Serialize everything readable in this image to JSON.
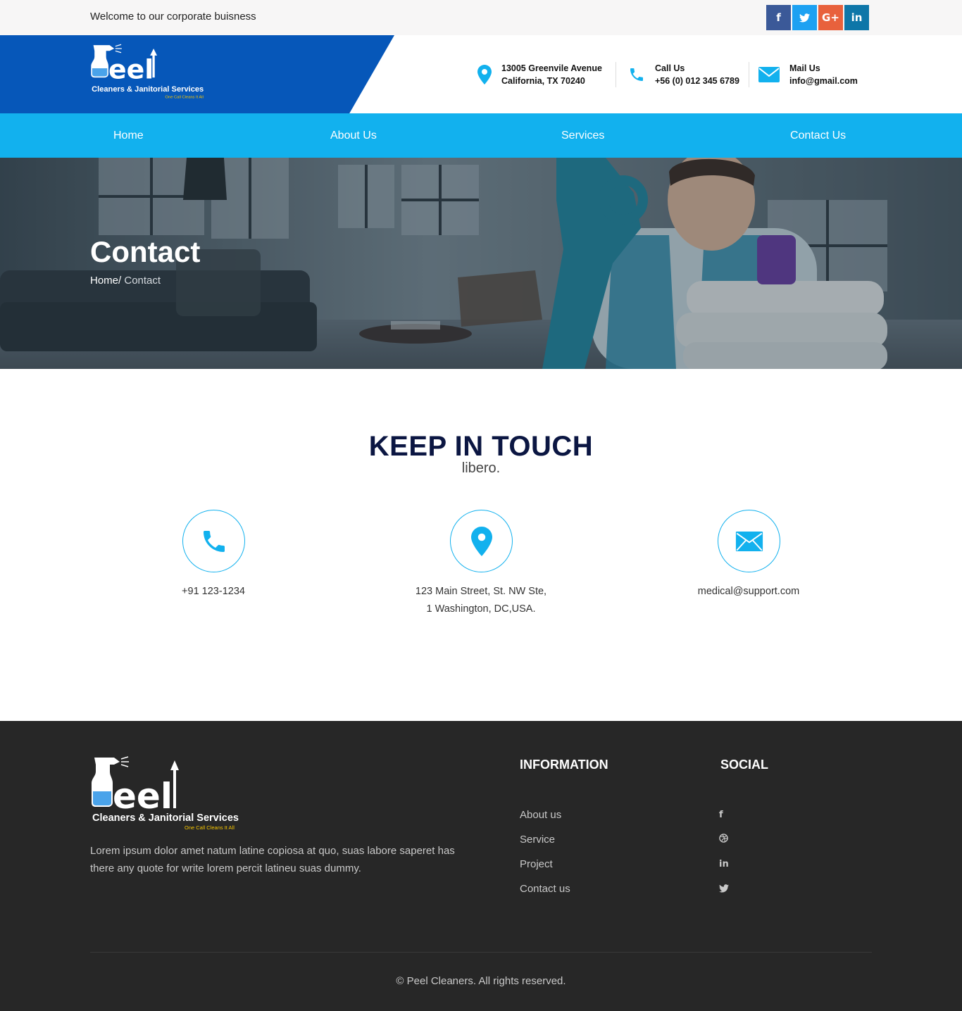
{
  "topbar": {
    "welcome": "Welcome to our corporate buisness",
    "social": [
      {
        "icon": "facebook-icon",
        "glyph": "f",
        "color": "#3b5998"
      },
      {
        "icon": "twitter-icon",
        "glyph": "t",
        "color": "#1da1f2"
      },
      {
        "icon": "google-plus-icon",
        "glyph": "G+",
        "color": "#dd4b39"
      },
      {
        "icon": "linkedin-icon",
        "glyph": "in",
        "color": "#0e76a8"
      }
    ]
  },
  "brand": {
    "name": "eel",
    "tagline": "Cleaners & Janitorial Services",
    "slogan": "One Call Cleans It All",
    "header_color": "#0657b9"
  },
  "header_contacts": {
    "address": {
      "line1": "13005 Greenvile Avenue",
      "line2": "California, TX 70240"
    },
    "phone": {
      "line1": "Call Us",
      "line2": "+56 (0) 012 345 6789"
    },
    "mail": {
      "line1": "Mail Us",
      "line2": "info@gmail.com"
    }
  },
  "nav": {
    "items": [
      "Home",
      "About Us",
      "Services",
      "Contact Us"
    ],
    "color": "#12b1ee"
  },
  "hero": {
    "title": "Contact",
    "breadcrumb_home": "Home/",
    "breadcrumb_current": " Contact"
  },
  "keep_in_touch": {
    "title": "KEEP IN TOUCH",
    "subtitle": "libero.",
    "phone": "+91 123-1234",
    "address_line1": "123 Main Street, St. NW Ste,",
    "address_line2": "1 Washington, DC,USA.",
    "email": "medical@support.com"
  },
  "footer": {
    "description": "Lorem ipsum dolor amet natum latine copiosa at quo, suas labore saperet has there any quote for write lorem percit latineu suas dummy.",
    "information_title": "INFORMATION",
    "information_links": [
      "About us",
      "Service",
      "Project",
      "Contact us"
    ],
    "social_title": "SOCIAL",
    "social_icons": [
      "facebook-icon",
      "dribbble-icon",
      "linkedin-icon",
      "twitter-icon"
    ],
    "copyright": "© Peel Cleaners. All rights reserved."
  }
}
